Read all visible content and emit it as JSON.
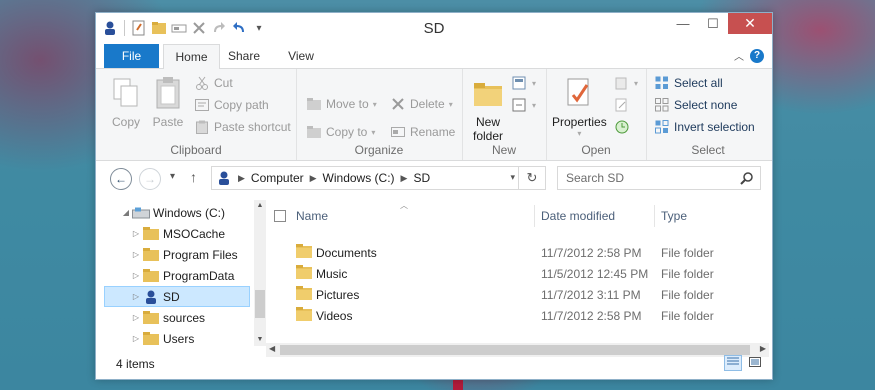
{
  "window": {
    "title": "SD"
  },
  "quick_access": {
    "dropdown": "▾"
  },
  "window_controls": {
    "minimize": "—",
    "maximize": "☐",
    "close": "✕"
  },
  "ribbon_tabs": [
    "File",
    "Home",
    "Share",
    "View"
  ],
  "ribbon": {
    "clipboard": {
      "label": "Clipboard",
      "copy": "Copy",
      "paste": "Paste",
      "cut": "Cut",
      "copy_path": "Copy path",
      "paste_shortcut": "Paste shortcut"
    },
    "organize": {
      "label": "Organize",
      "move_to": "Move to",
      "copy_to": "Copy to",
      "delete": "Delete",
      "rename": "Rename"
    },
    "new": {
      "label": "New",
      "new_folder_line1": "New",
      "new_folder_line2": "folder"
    },
    "open": {
      "label": "Open",
      "properties": "Properties"
    },
    "select": {
      "label": "Select",
      "select_all": "Select all",
      "select_none": "Select none",
      "invert_selection": "Invert selection"
    }
  },
  "address": {
    "crumbs": [
      "Computer",
      "Windows (C:)",
      "SD"
    ],
    "search_placeholder": "Search SD"
  },
  "nav_tree": [
    {
      "label": "Windows (C:)",
      "icon": "drive-icon",
      "expanded": true,
      "selected": false
    },
    {
      "label": "MSOCache",
      "icon": "folder-icon",
      "selected": false
    },
    {
      "label": "Program Files",
      "icon": "folder-icon",
      "selected": false
    },
    {
      "label": "ProgramData",
      "icon": "folder-icon",
      "selected": false
    },
    {
      "label": "SD",
      "icon": "user-folder-icon",
      "selected": true
    },
    {
      "label": "sources",
      "icon": "folder-icon",
      "selected": false
    },
    {
      "label": "Users",
      "icon": "folder-icon",
      "selected": false
    }
  ],
  "columns": {
    "name": "Name",
    "date_modified": "Date modified",
    "type": "Type"
  },
  "files": [
    {
      "name": "Documents",
      "date": "11/7/2012 2:58 PM",
      "type": "File folder"
    },
    {
      "name": "Music",
      "date": "11/5/2012 12:45 PM",
      "type": "File folder"
    },
    {
      "name": "Pictures",
      "date": "11/7/2012 3:11 PM",
      "type": "File folder"
    },
    {
      "name": "Videos",
      "date": "11/7/2012 2:58 PM",
      "type": "File folder"
    }
  ],
  "status": {
    "count": "4 items"
  },
  "colors": {
    "accent": "#1979ca",
    "selection": "#cce8ff",
    "close": "#c75050",
    "folder": "#e8c15a"
  }
}
